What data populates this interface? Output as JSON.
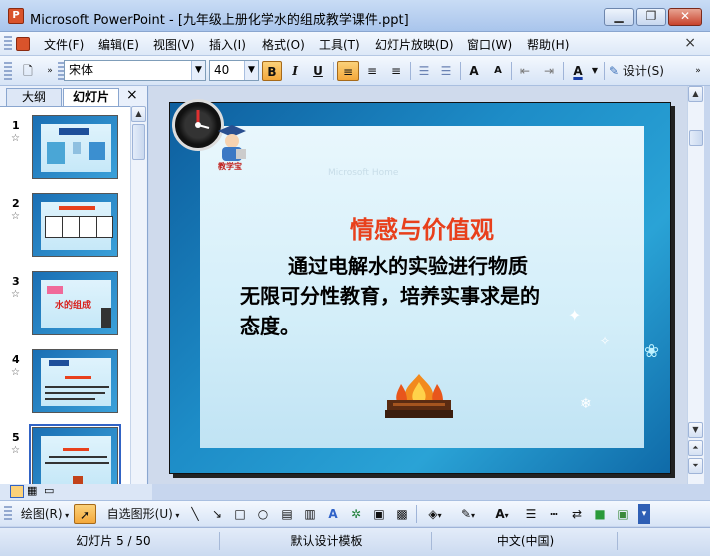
{
  "window": {
    "title": "Microsoft PowerPoint - [九年级上册化学水的组成教学课件.ppt]",
    "app_icon": "powerpoint-icon",
    "controls": [
      "minimize-icon",
      "restore-icon",
      "close-icon"
    ]
  },
  "menu": {
    "items": [
      "文件(F)",
      "编辑(E)",
      "视图(V)",
      "插入(I)",
      "格式(O)",
      "工具(T)",
      "幻灯片放映(D)",
      "窗口(W)",
      "帮助(H)"
    ],
    "close_glyph": "×"
  },
  "toolbar": {
    "font_name": "宋体",
    "font_size": "40",
    "bold": "B",
    "italic": "I",
    "underline": "U",
    "grow": "A",
    "shrink": "A",
    "font_color": "A",
    "design_label": "设计(S)"
  },
  "left_pane": {
    "tabs": [
      "大纲",
      "幻灯片"
    ],
    "close_glyph": "×",
    "slides": [
      {
        "num": "1"
      },
      {
        "num": "2"
      },
      {
        "num": "3",
        "label": "水的组成"
      },
      {
        "num": "4"
      },
      {
        "num": "5"
      }
    ]
  },
  "slide": {
    "logo_caption": "教学宝",
    "faint_text": "Microsoft Home",
    "heading": "情感与价值观",
    "body_lines": [
      "通过电解水的实验进行物质",
      "无限可分性教育，培养实事求是的",
      "态度。"
    ]
  },
  "drawbar": {
    "draw_label": "绘图(R)",
    "autoshape_label": "自选图形(U)"
  },
  "status": {
    "slide_info": "幻灯片 5 / 50",
    "template": "默认设计模板",
    "language": "中文(中国)"
  },
  "colors": {
    "heading": "#e8401c",
    "accent": "#3163c5"
  }
}
